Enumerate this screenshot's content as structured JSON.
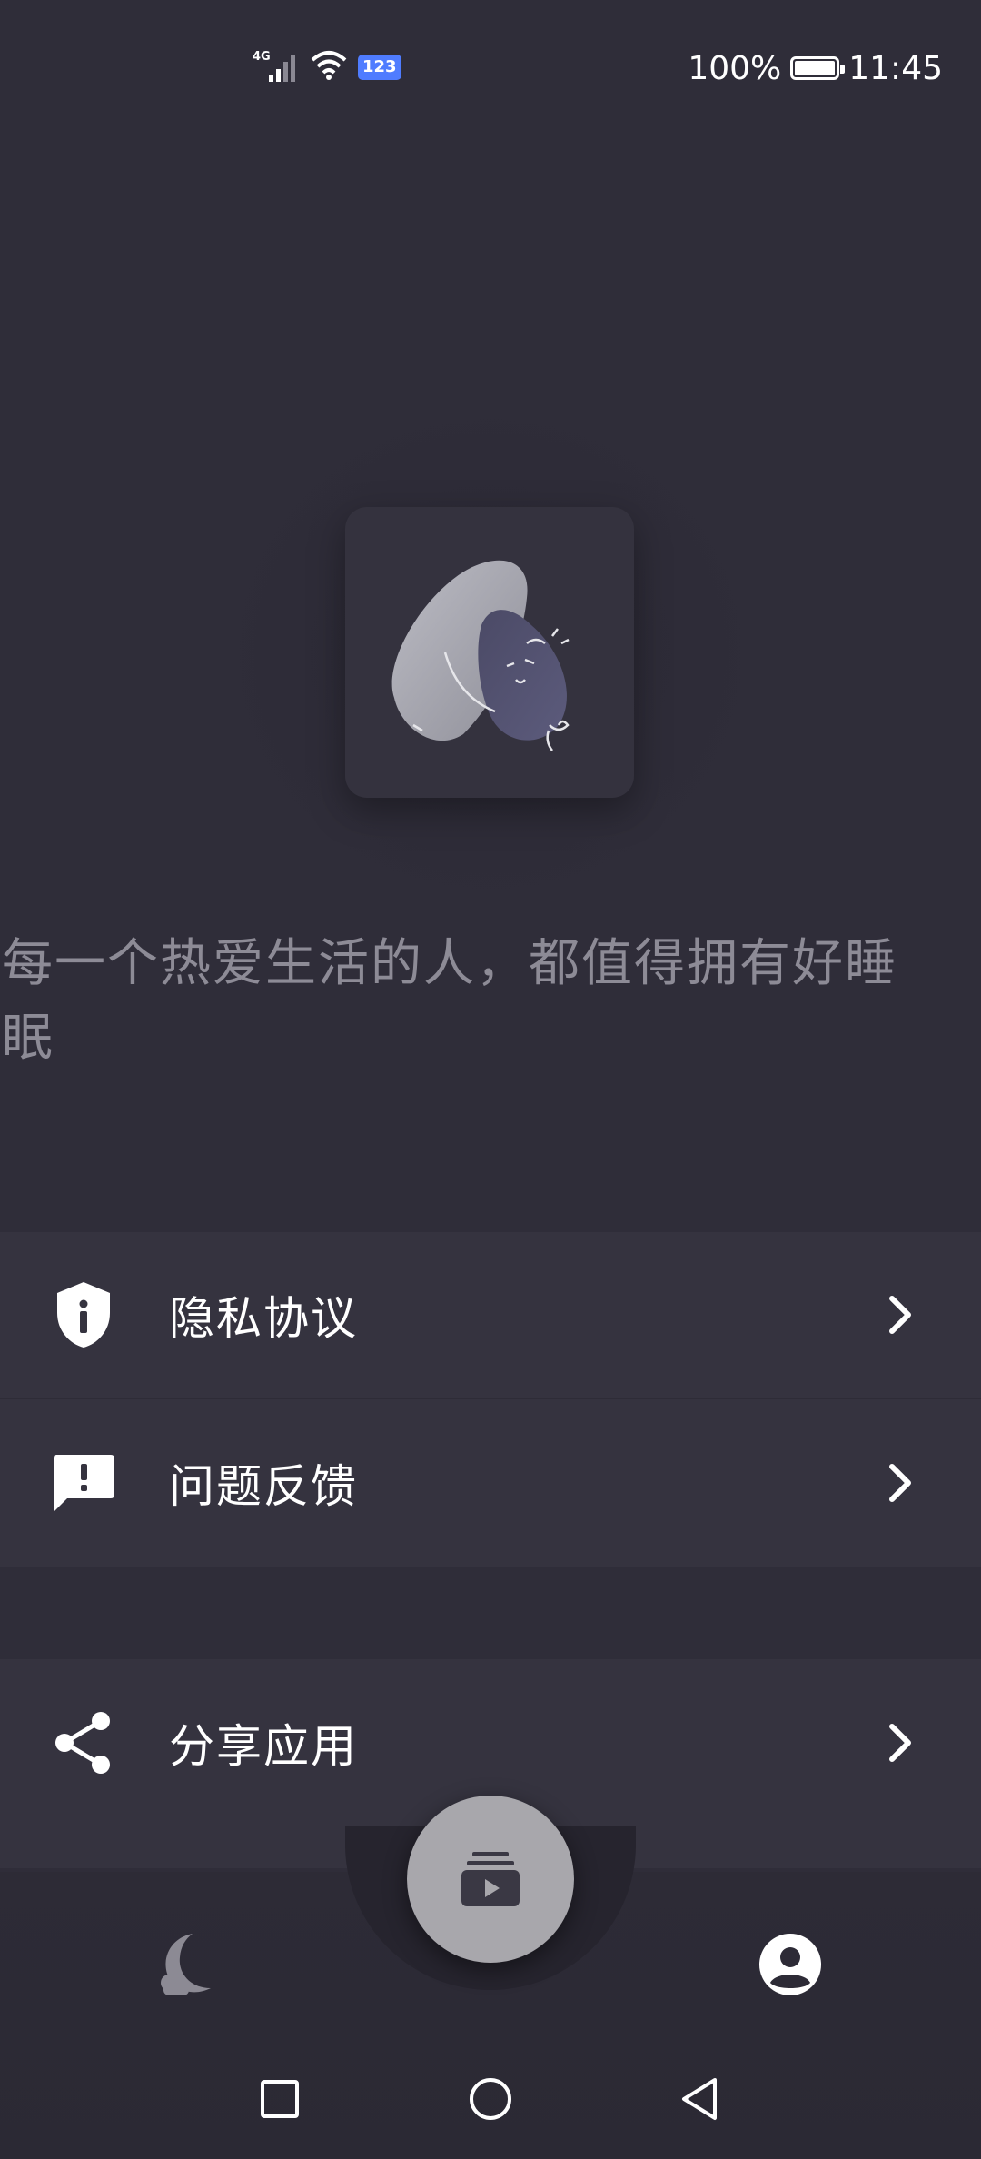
{
  "status_bar": {
    "network": "4G",
    "badge": "123",
    "battery": "100%",
    "time": "11:45"
  },
  "slogan": "每一个热爱生活的人，都值得拥有好睡眠",
  "menu_group_1": [
    {
      "label": "隐私协议",
      "icon": "shield-info-icon"
    },
    {
      "label": "问题反馈",
      "icon": "feedback-icon"
    }
  ],
  "menu_group_2": [
    {
      "label": "分享应用",
      "icon": "share-icon"
    }
  ],
  "bottom_nav": {
    "left_icon": "moon-icon",
    "center_icon": "playlist-play-icon",
    "right_icon": "account-icon"
  },
  "system_nav": [
    "recent-apps-icon",
    "home-icon",
    "back-icon"
  ],
  "colors": {
    "background": "#2f2d39",
    "row_background": "#35333f",
    "fab": "#a8a7ac",
    "text_primary": "#ffffff",
    "text_secondary": "#8d8b96",
    "badge": "#4f7cff"
  }
}
